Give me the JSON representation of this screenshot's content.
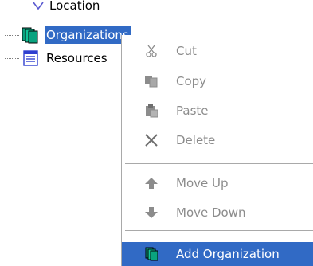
{
  "tree": {
    "items": [
      {
        "label": "Location",
        "icon": "location-icon"
      },
      {
        "label": "Organizations",
        "icon": "organizations-icon",
        "selected": true
      },
      {
        "label": "Resources",
        "icon": "resources-icon"
      }
    ]
  },
  "context_menu": {
    "items": [
      {
        "label": "Cut",
        "icon": "scissors-icon",
        "enabled": false
      },
      {
        "label": "Copy",
        "icon": "copy-icon",
        "enabled": false
      },
      {
        "label": "Paste",
        "icon": "paste-icon",
        "enabled": false
      },
      {
        "label": "Delete",
        "icon": "delete-x-icon",
        "enabled": false
      },
      {
        "label": "Move Up",
        "icon": "arrow-up-icon",
        "enabled": false
      },
      {
        "label": "Move Down",
        "icon": "arrow-down-icon",
        "enabled": false
      },
      {
        "label": "Add Organization",
        "icon": "add-organization-icon",
        "enabled": true,
        "highlighted": true
      }
    ]
  },
  "colors": {
    "selection": "#316ac5",
    "disabled_text": "#8c8c8c",
    "org_icon": "#0aa37f",
    "resources_icon": "#2f3fd0"
  }
}
